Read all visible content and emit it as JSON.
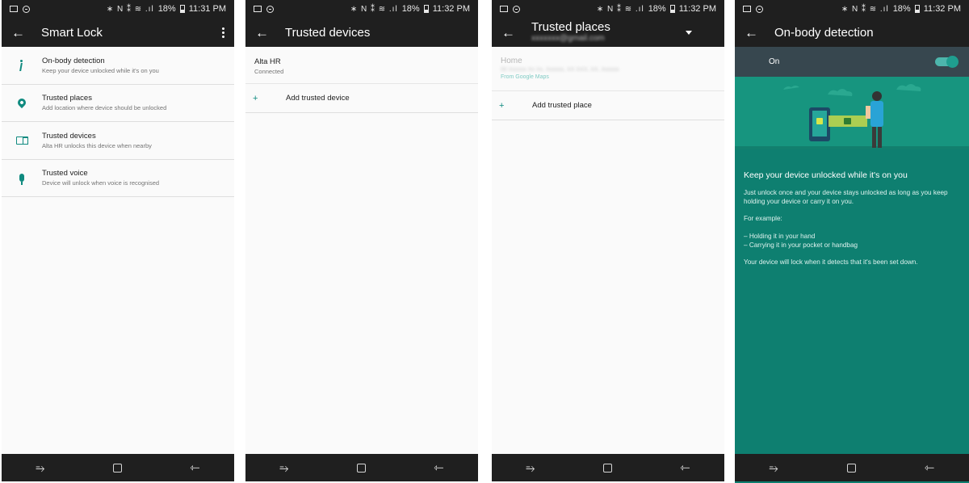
{
  "status": {
    "time1": "11:31 PM",
    "time2": "11:32 PM",
    "battery": "18%",
    "glyphs": "∗ N ⁑ ≋ .ıl"
  },
  "nav": {
    "recent": "⥱",
    "back": "⇽"
  },
  "back_arrow": "←",
  "screen1": {
    "title": "Smart Lock",
    "items": [
      {
        "title": "On-body detection",
        "subtitle": "Keep your device unlocked while it's on you",
        "icon": "walking-person-icon"
      },
      {
        "title": "Trusted places",
        "subtitle": "Add location where device should be unlocked",
        "icon": "location-pin-icon"
      },
      {
        "title": "Trusted devices",
        "subtitle": "Alta HR unlocks this device when nearby",
        "icon": "devices-icon"
      },
      {
        "title": "Trusted voice",
        "subtitle": "Device will unlock when voice is recognised",
        "icon": "microphone-icon"
      }
    ]
  },
  "screen2": {
    "title": "Trusted devices",
    "device_name": "Alta HR",
    "device_status": "Connected",
    "add_plus": "+",
    "add_label": "Add trusted device"
  },
  "screen3": {
    "title": "Trusted places",
    "account": "xxxxxxx@gmail.com",
    "home_label": "Home",
    "home_address": "00 Xxxxxx Xx Xx, Xxxxxx, XX XXX, XX, Xxxxxx",
    "home_source": "From Google Maps",
    "add_plus": "+",
    "add_label": "Add trusted place"
  },
  "screen4": {
    "title": "On-body detection",
    "toggle_label": "On",
    "toggle_state": true,
    "heading": "Keep your device unlocked while it's on you",
    "para1": "Just unlock once and your device stays unlocked as long as you keep holding your device or carry it on you.",
    "example_label": "For example:",
    "bullet1": "– Holding it in your hand",
    "bullet2": "– Carrying it in your pocket or handbag",
    "para2": "Your device will lock when it detects that it's been set down."
  },
  "colors": {
    "accent": "#0f8a7f",
    "teal_bg": "#0e7f70",
    "bar": "#1f1f1f"
  }
}
